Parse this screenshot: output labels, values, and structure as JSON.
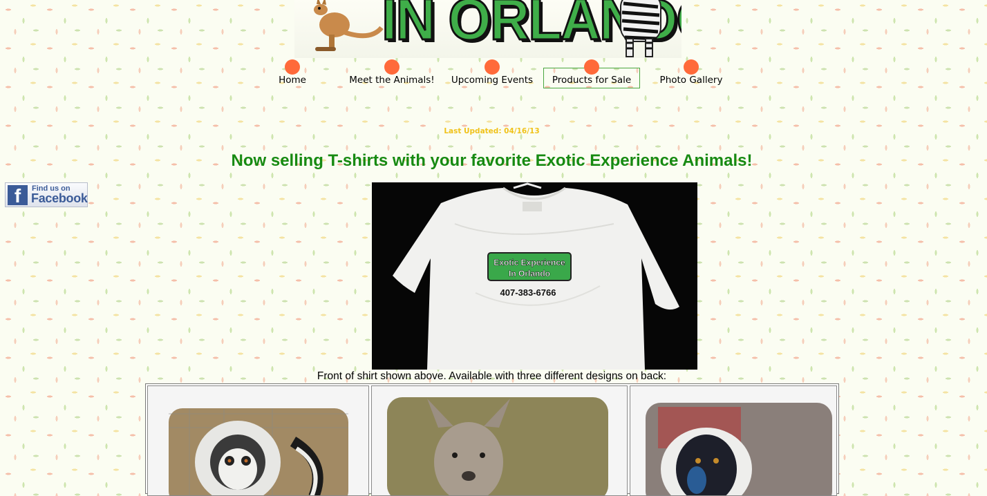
{
  "nav": {
    "items": [
      {
        "label": "Home",
        "active": false
      },
      {
        "label": "Meet the Animals!",
        "active": false
      },
      {
        "label": "Upcoming Events",
        "active": false
      },
      {
        "label": "Products for Sale",
        "active": true
      },
      {
        "label": "Photo Gallery",
        "active": false
      }
    ]
  },
  "banner": {
    "logo_text": "IN ORLANDO"
  },
  "last_updated": "Last Updated:  04/16/13",
  "headline": "Now selling T-shirts with your favorite Exotic Experience Animals!",
  "facebook": {
    "line1": "Find us on",
    "line2": "Facebook"
  },
  "shirt_print": {
    "logo_line1": "Exotic Experience",
    "logo_line2": "In Orlando",
    "phone": "407-383-6766"
  },
  "caption": "Front of shirt shown above.  Available with three different designs on back:",
  "designs": [
    {
      "animal": "ring-tailed lemur"
    },
    {
      "animal": "kangaroo"
    },
    {
      "animal": "black-and-white ruffed lemur"
    }
  ],
  "colors": {
    "nav_dot": "#ff6a3a",
    "headline": "#178a12",
    "last_updated": "#f0c21a",
    "active_frame": "#49a63e",
    "facebook_blue": "#3b5b98"
  }
}
